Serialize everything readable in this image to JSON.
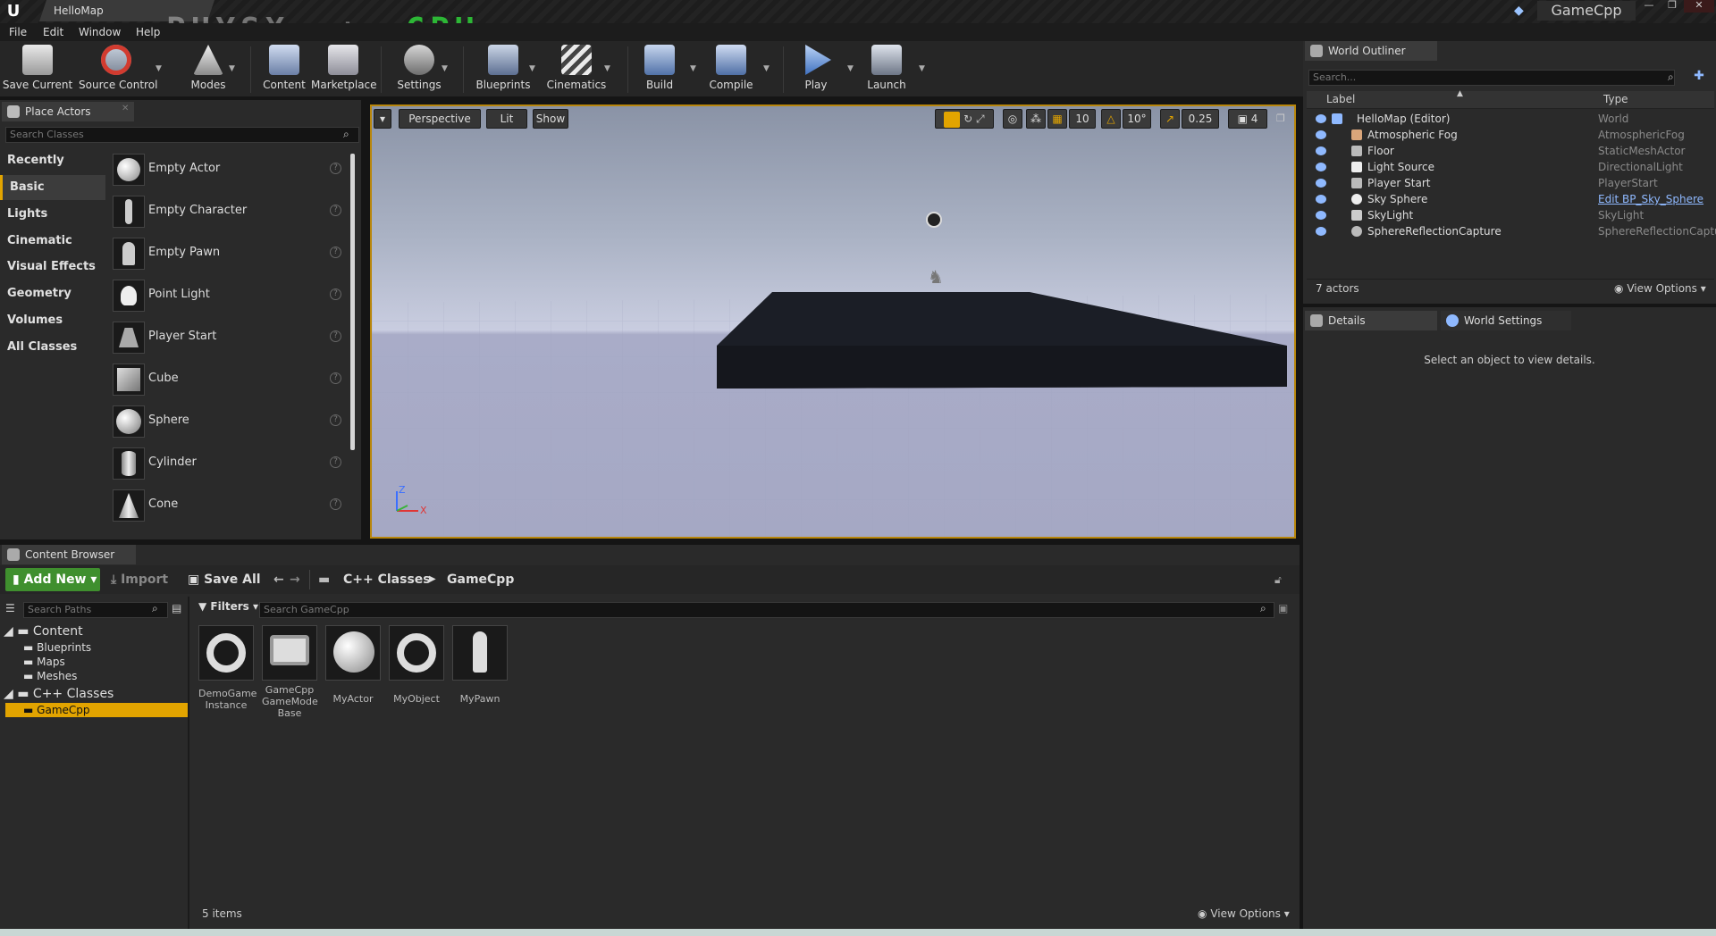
{
  "title_bar": {
    "logo": "U",
    "map_tab": "HelloMap",
    "overlay_physx": "PHYSX",
    "overlay_plus": "+",
    "overlay_cpu": "CPU",
    "project": "GameCpp"
  },
  "menu": [
    "File",
    "Edit",
    "Window",
    "Help"
  ],
  "toolbar": [
    {
      "label": "Save Current",
      "icon": "save-icon"
    },
    {
      "label": "Source Control",
      "icon": "source-control-icon"
    },
    {
      "label": "Modes",
      "icon": "modes-icon"
    },
    {
      "label": "Content",
      "icon": "content-icon"
    },
    {
      "label": "Marketplace",
      "icon": "marketplace-icon"
    },
    {
      "label": "Settings",
      "icon": "settings-icon"
    },
    {
      "label": "Blueprints",
      "icon": "blueprints-icon"
    },
    {
      "label": "Cinematics",
      "icon": "cinematics-icon"
    },
    {
      "label": "Build",
      "icon": "build-icon"
    },
    {
      "label": "Compile",
      "icon": "compile-icon"
    },
    {
      "label": "Play",
      "icon": "play-icon"
    },
    {
      "label": "Launch",
      "icon": "launch-icon"
    }
  ],
  "place_actors": {
    "tab": "Place Actors",
    "search_placeholder": "Search Classes",
    "categories": [
      "Recently Placed",
      "Basic",
      "Lights",
      "Cinematic",
      "Visual Effects",
      "Geometry",
      "Volumes",
      "All Classes"
    ],
    "active_category": "Basic",
    "actors": [
      "Empty Actor",
      "Empty Character",
      "Empty Pawn",
      "Point Light",
      "Player Start",
      "Cube",
      "Sphere",
      "Cylinder",
      "Cone"
    ],
    "help_glyph": "?"
  },
  "viewport": {
    "dropdown": "▾",
    "perspective": "Perspective",
    "lit": "Lit",
    "show": "Show",
    "grid_snap": "10",
    "rotation_snap": "10°",
    "scale_snap": "0.25",
    "camera_speed": "4",
    "axis_z": "Z",
    "axis_x": "X"
  },
  "world_outliner": {
    "tab": "World Outliner",
    "search_placeholder": "Search...",
    "col_label": "Label",
    "col_type": "Type",
    "rows": [
      {
        "label": "HelloMap (Editor)",
        "type": "World"
      },
      {
        "label": "Atmospheric Fog",
        "type": "AtmosphericFog"
      },
      {
        "label": "Floor",
        "type": "StaticMeshActor"
      },
      {
        "label": "Light Source",
        "type": "DirectionalLight"
      },
      {
        "label": "Player Start",
        "type": "PlayerStart"
      },
      {
        "label": "Sky Sphere",
        "type": "Edit BP_Sky_Sphere"
      },
      {
        "label": "SkyLight",
        "type": "SkyLight"
      },
      {
        "label": "SphereReflectionCapture",
        "type": "SphereReflectionCaptu"
      }
    ],
    "actor_count": "7 actors",
    "view_options": "View Options"
  },
  "details": {
    "tab": "Details",
    "world_settings_tab": "World Settings",
    "empty_message": "Select an object to view details."
  },
  "content_browser": {
    "tab": "Content Browser",
    "add_new": "Add New",
    "import": "Import",
    "save_all": "Save All",
    "path": [
      "C++ Classes",
      "GameCpp"
    ],
    "search_paths_placeholder": "Search Paths",
    "filters": "Filters",
    "search_placeholder": "Search GameCpp",
    "tree": [
      {
        "label": "Content",
        "level": 0
      },
      {
        "label": "Blueprints",
        "level": 1
      },
      {
        "label": "Maps",
        "level": 1
      },
      {
        "label": "Meshes",
        "level": 1
      },
      {
        "label": "C++ Classes",
        "level": 0
      },
      {
        "label": "GameCpp",
        "level": 1,
        "selected": true
      }
    ],
    "assets": [
      {
        "name": "DemoGame Instance"
      },
      {
        "name": "GameCpp GameMode Base"
      },
      {
        "name": "MyActor"
      },
      {
        "name": "MyObject"
      },
      {
        "name": "MyPawn"
      }
    ],
    "item_count": "5 items",
    "view_options": "View Options"
  },
  "colors": {
    "accent": "#e2a400",
    "selected": "#e2a400",
    "add_new": "#3f8f2e"
  }
}
